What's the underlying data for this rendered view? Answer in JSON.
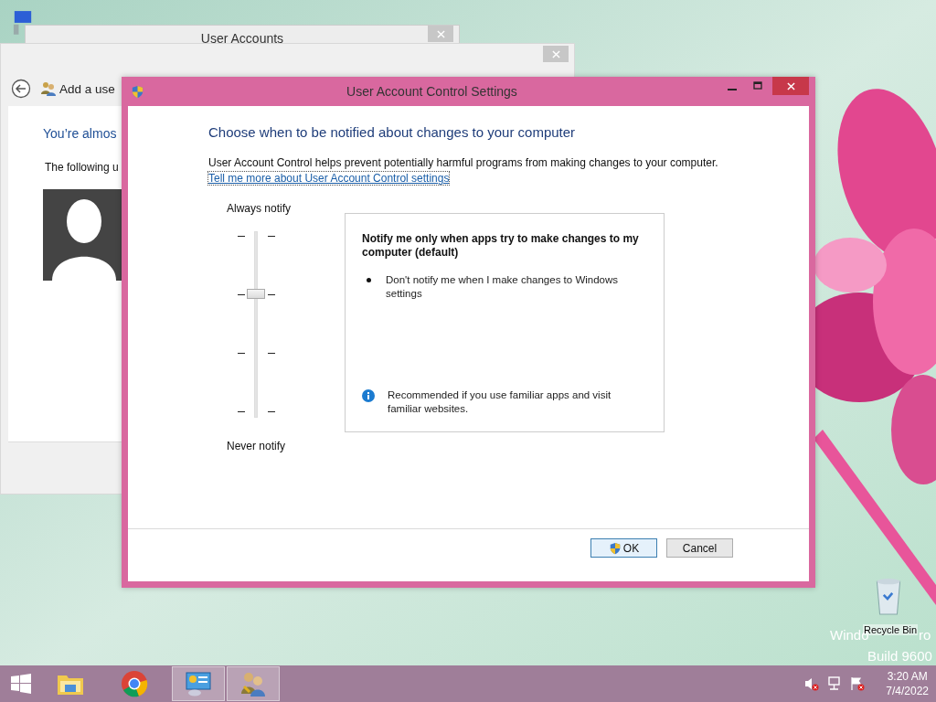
{
  "desktop": {
    "recycle_bin": {
      "label": "Recycle Bin"
    },
    "watermark": {
      "line_1_start": "Windo",
      "line_1_end": "ro",
      "line_2": "Build 9600"
    }
  },
  "background_windows": [
    {
      "title": "User Accounts"
    },
    {
      "breadcrumb": "Add a use",
      "heading": "You’re almos",
      "text": "The following u"
    }
  ],
  "dialog": {
    "title": "User Account Control Settings",
    "heading": "Choose when to be notified about changes to your computer",
    "description": "User Account Control helps prevent potentially harmful programs from making changes to your computer.",
    "link": "Tell me more about User Account Control settings",
    "slider": {
      "top_label": "Always notify",
      "bottom_label": "Never notify",
      "level": 0.667
    },
    "info": {
      "title": "Notify me only when apps try to make changes to my computer (default)",
      "bullets": [
        "Don't notify me when I make changes to Windows settings"
      ],
      "note": "Recommended if you use familiar apps and visit familiar websites."
    },
    "buttons": [
      {
        "label": "OK",
        "kind": "shield"
      },
      {
        "label": "Cancel",
        "kind": "plain"
      }
    ]
  },
  "taskbar": {
    "items": [
      {
        "kind": "start",
        "active": false
      },
      {
        "kind": "folder",
        "active": false
      },
      {
        "kind": "browser",
        "active": false
      },
      {
        "kind": "control-panel",
        "active": true
      },
      {
        "kind": "users",
        "active": true
      }
    ],
    "clock": {
      "time": "3:20 AM",
      "date": "7/4/2022"
    }
  }
}
